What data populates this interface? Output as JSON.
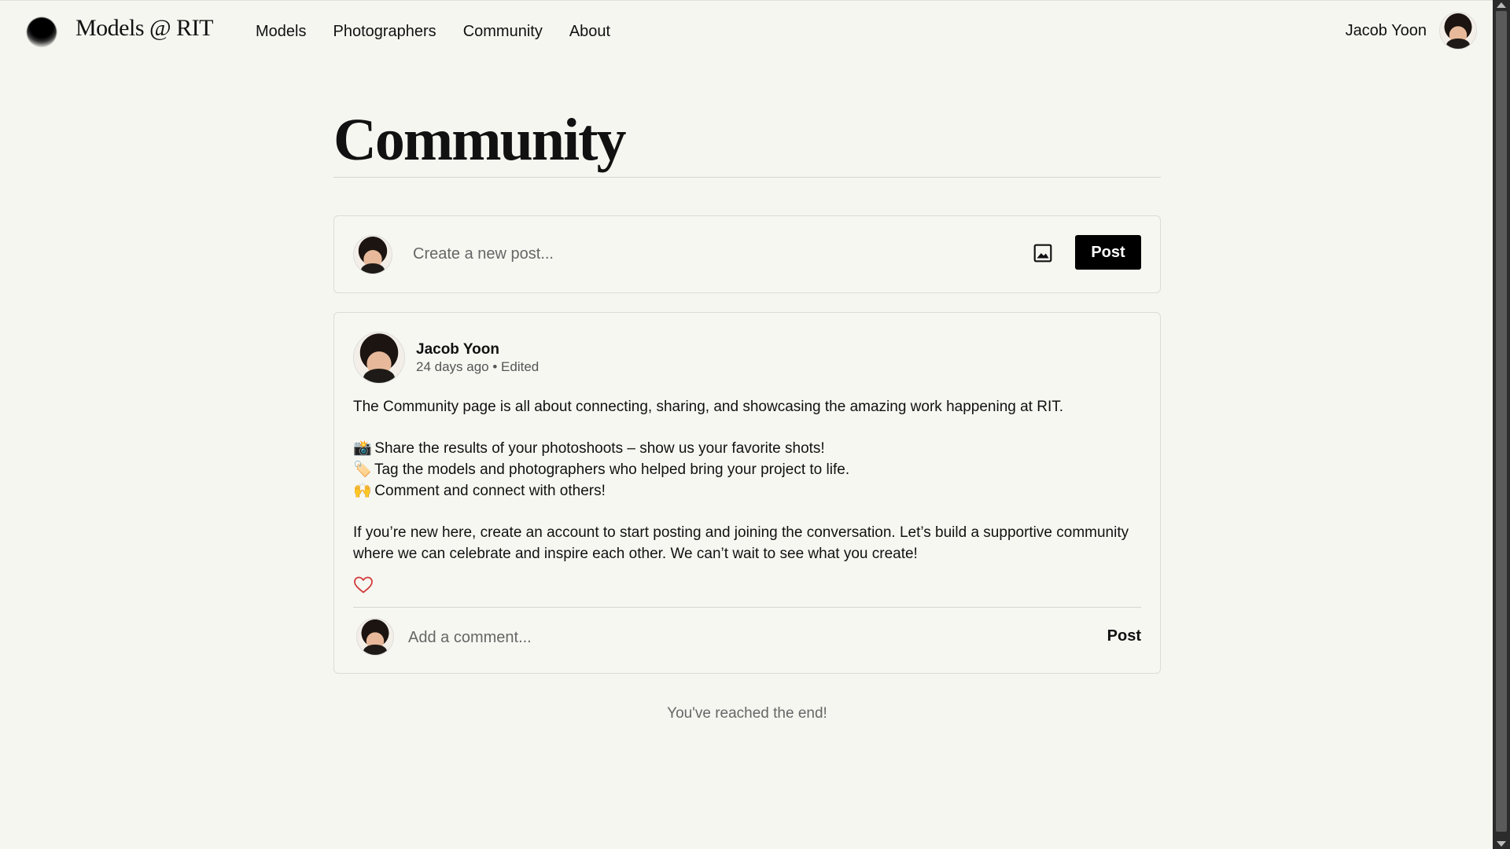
{
  "header": {
    "logo_text": "Models @ RIT",
    "nav": [
      {
        "label": "Models"
      },
      {
        "label": "Photographers"
      },
      {
        "label": "Community"
      },
      {
        "label": "About"
      }
    ],
    "user_name": "Jacob Yoon"
  },
  "main": {
    "title": "Community",
    "composer": {
      "placeholder": "Create a new post...",
      "post_label": "Post"
    },
    "post": {
      "author": "Jacob Yoon",
      "meta": "24 days ago • Edited",
      "intro": "The Community page is all about connecting, sharing, and showcasing the amazing work happening at RIT.",
      "bullets": [
        {
          "emoji": "📸",
          "text": "Share the results of your photoshoots – show us your favorite shots!"
        },
        {
          "emoji": "🏷️",
          "text": "Tag the models and photographers who helped bring your project to life."
        },
        {
          "emoji": "🙌",
          "text": "Comment and connect with others!"
        }
      ],
      "closing": "If you’re new here, create an account to start posting and joining the conversation. Let’s build a supportive community where we can celebrate and inspire each other. We can’t wait to see what you create!",
      "liked": false,
      "comment": {
        "placeholder": "Add a comment...",
        "post_label": "Post"
      }
    },
    "end_text": "You've reached the end!"
  },
  "icons": {
    "image": "image-icon",
    "heart": "heart-outline-icon",
    "heart_color": "#d23c3c"
  }
}
